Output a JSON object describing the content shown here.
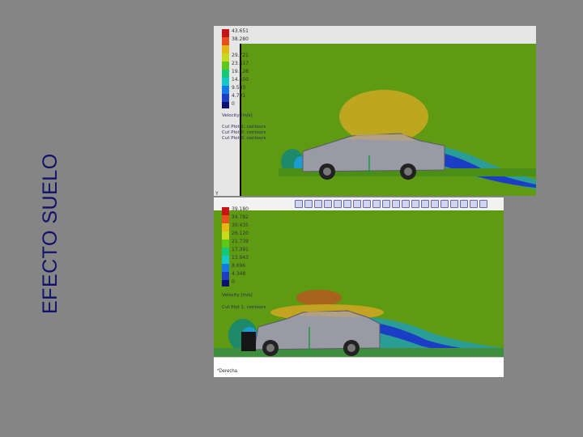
{
  "slide": {
    "title": "EFECTO SUELO"
  },
  "colors": {
    "background": "#858585",
    "title": "#11116b",
    "flow_field": "#5e9a12",
    "high_velocity": "#d6b21a",
    "low_velocity": "#1b3ec4",
    "car_body": "#9a9aa6"
  },
  "top_view": {
    "legend_values": [
      "43.651",
      "38.280",
      "",
      "29.721",
      "23.417",
      "19.128",
      "14.550",
      "9.593",
      "4.791",
      "0"
    ],
    "legend_title": "Velocity [m/s]",
    "cut_plot_lines": [
      "Cut Plot 1: contours",
      "Cut Plot 2: contours",
      "Cut Plot 3: contours"
    ]
  },
  "bottom_view": {
    "legend_values": [
      "39.180",
      "34.782",
      "30.435",
      "26.120",
      "21.739",
      "17.391",
      "13.043",
      "8.696",
      "4.348",
      "0"
    ],
    "legend_title": "Velocity [m/s]",
    "cut_plot_line": "Cut Plot 1: contours",
    "status_label": "*Derecha"
  }
}
